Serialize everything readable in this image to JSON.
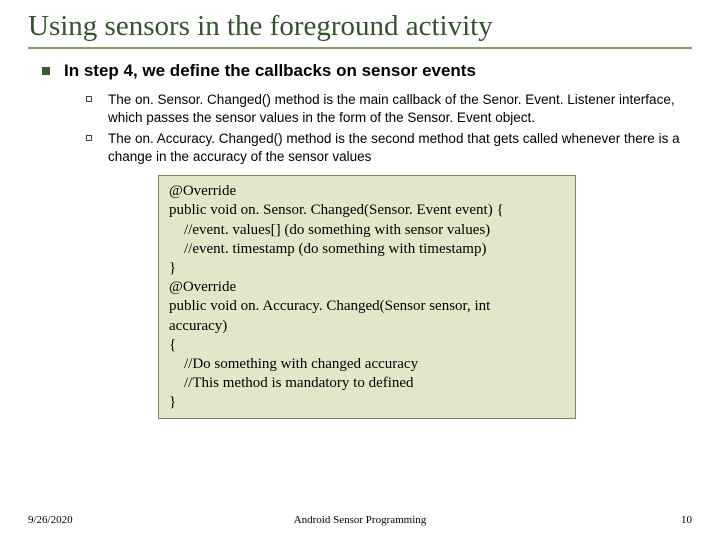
{
  "title": "Using sensors in the foreground activity",
  "level1": "In step 4, we define the callbacks on sensor events",
  "bullets": [
    "The on. Sensor. Changed() method is the main callback of the Senor. Event. Listener interface, which passes the sensor values in the form of the Sensor. Event object.",
    "The on. Accuracy. Changed() method is the second method that gets called whenever there is a change in the accuracy of the sensor values"
  ],
  "code": [
    "@Override",
    "public void on. Sensor. Changed(Sensor. Event event) {",
    "    //event. values[] (do something with sensor values)",
    "    //event. timestamp (do something with timestamp)",
    "}",
    "@Override",
    "public void on. Accuracy. Changed(Sensor sensor, int",
    "accuracy)",
    "{",
    "    //Do something with changed accuracy",
    "    //This method is mandatory to defined",
    "}"
  ],
  "footer": {
    "date": "9/26/2020",
    "center": "Android Sensor Programming",
    "page": "10"
  }
}
